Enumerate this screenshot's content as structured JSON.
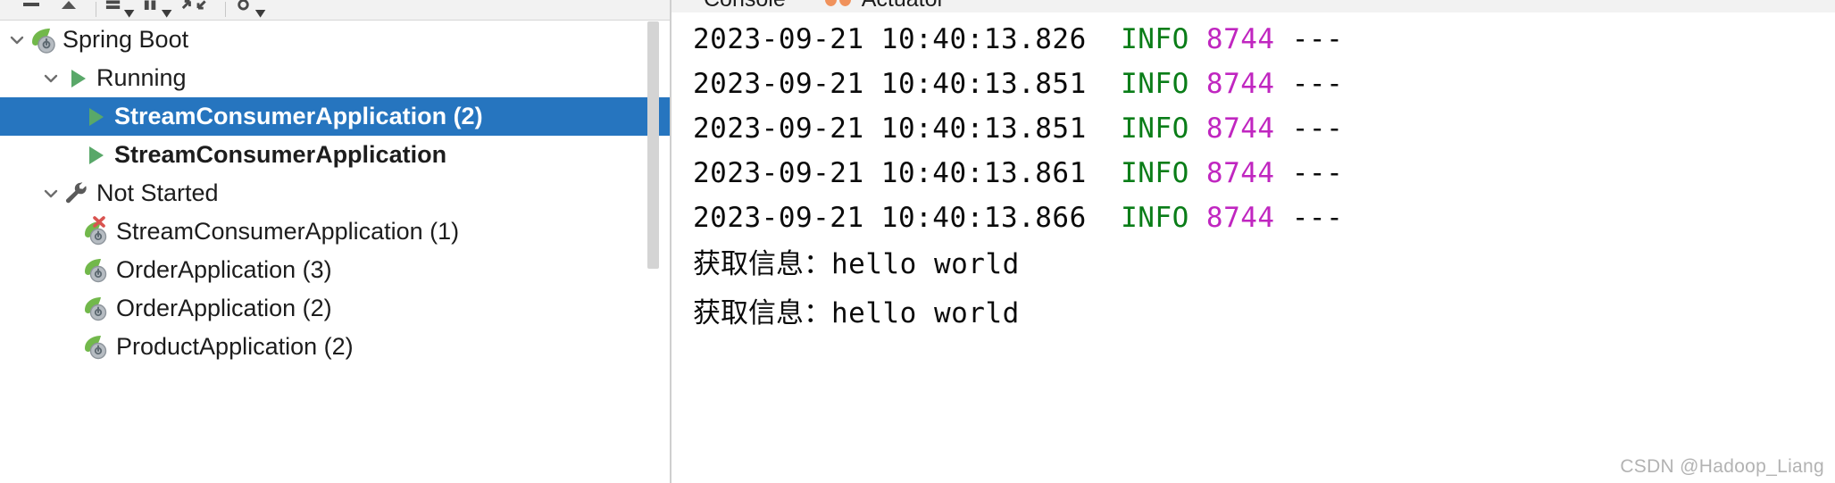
{
  "toolbar": {
    "items": [
      {
        "name": "minimize-icon",
        "glyph": "minus"
      },
      {
        "name": "rerun-icon",
        "glyph": "up-arrow"
      },
      {
        "name": "run-dropdown-icon",
        "glyph": "stack-dropdown"
      },
      {
        "name": "filter-dropdown-icon",
        "glyph": "bars-dropdown"
      },
      {
        "name": "expand-collapse-icon",
        "glyph": "arrows"
      },
      {
        "name": "settings-dropdown-icon",
        "glyph": "gear-dropdown"
      }
    ]
  },
  "tree": {
    "nodes": [
      {
        "label": "Spring Boot",
        "icon": "spring-boot-leaf-icon",
        "arrow": "chevron-down",
        "indent": 0,
        "bold": false,
        "selected": false
      },
      {
        "label": "Running",
        "icon": "green-run-triangle-icon",
        "arrow": "chevron-down",
        "indent": 1,
        "bold": false,
        "selected": false
      },
      {
        "label": "StreamConsumerApplication (2)",
        "icon": "green-run-triangle-icon",
        "arrow": "none",
        "indent": 2,
        "bold": true,
        "selected": true
      },
      {
        "label": "StreamConsumerApplication",
        "icon": "green-run-triangle-icon",
        "arrow": "none",
        "indent": 2,
        "bold": true,
        "selected": false
      },
      {
        "label": "Not Started",
        "icon": "wrench-icon",
        "arrow": "chevron-down",
        "indent": 1,
        "bold": false,
        "selected": false
      },
      {
        "label": "StreamConsumerApplication (1)",
        "icon": "spring-boot-leaf-error-icon",
        "arrow": "none",
        "indent": 2,
        "bold": false,
        "selected": false
      },
      {
        "label": "OrderApplication (3)",
        "icon": "spring-boot-leaf-icon",
        "arrow": "none",
        "indent": 2,
        "bold": false,
        "selected": false
      },
      {
        "label": "OrderApplication (2)",
        "icon": "spring-boot-leaf-icon",
        "arrow": "none",
        "indent": 2,
        "bold": false,
        "selected": false
      },
      {
        "label": "ProductApplication (2)",
        "icon": "spring-boot-leaf-icon",
        "arrow": "none",
        "indent": 2,
        "bold": false,
        "selected": false
      }
    ]
  },
  "console": {
    "tabs": [
      {
        "label": "Console",
        "active": true,
        "dots": 0
      },
      {
        "label": "Actuator",
        "active": false,
        "dots": 2
      }
    ],
    "lines": [
      {
        "type": "log",
        "timestamp": "2023-09-21 10:40:13.826",
        "level": "INFO",
        "pid": "8744",
        "tail": "---"
      },
      {
        "type": "log",
        "timestamp": "2023-09-21 10:40:13.851",
        "level": "INFO",
        "pid": "8744",
        "tail": "---"
      },
      {
        "type": "log",
        "timestamp": "2023-09-21 10:40:13.851",
        "level": "INFO",
        "pid": "8744",
        "tail": "---"
      },
      {
        "type": "log",
        "timestamp": "2023-09-21 10:40:13.861",
        "level": "INFO",
        "pid": "8744",
        "tail": "---"
      },
      {
        "type": "log",
        "timestamp": "2023-09-21 10:40:13.866",
        "level": "INFO",
        "pid": "8744",
        "tail": "---"
      },
      {
        "type": "text",
        "prefix": "获取信息：",
        "message": "hello world"
      },
      {
        "type": "text",
        "prefix": "获取信息：",
        "message": "hello world"
      }
    ]
  },
  "watermark": "CSDN @Hadoop_Liang",
  "colors": {
    "selection": "#2675bf",
    "log_level": "#0a7d18",
    "log_pid": "#c026c0",
    "tab_underline": "#93a5bb",
    "actuator_dot": "#f0925c",
    "spring_green": "#6db33f"
  }
}
